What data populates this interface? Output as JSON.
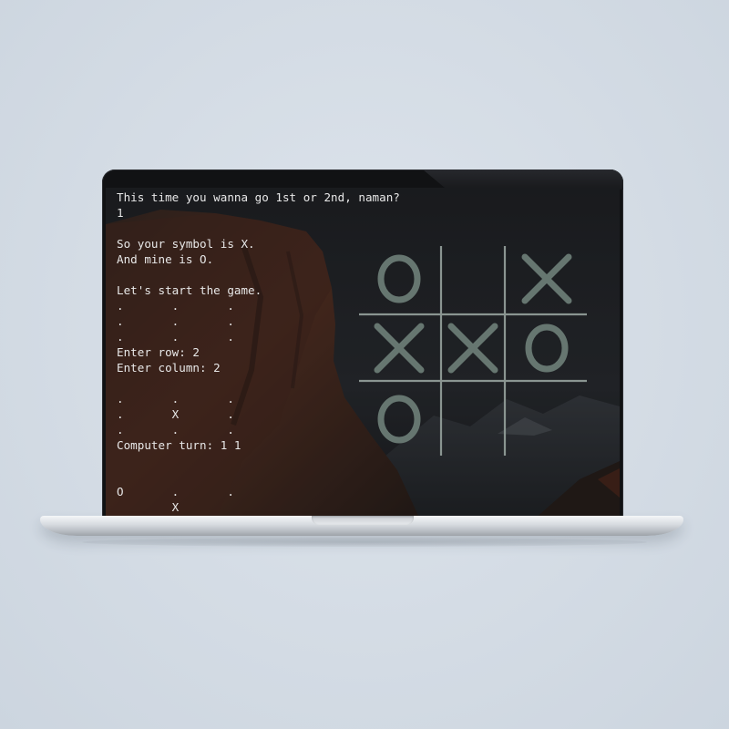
{
  "terminal": {
    "lines": [
      "This time you wanna go 1st or 2nd, naman?",
      "1",
      "",
      "So your symbol is X.",
      "And mine is O.",
      "",
      "Let's start the game.",
      ".       .       .",
      ".       .       .",
      ".       .       .",
      "Enter row: 2",
      "Enter column: 2",
      "",
      ".       .       .",
      ".       X       .",
      ".       .       .",
      "Computer turn: 1 1",
      "",
      "",
      "O       .       .",
      "        X        "
    ]
  },
  "board": {
    "cells": [
      "O",
      "",
      "X",
      "X",
      "X",
      "O",
      "O",
      "",
      ""
    ],
    "mark_color": "#667670",
    "line_color": "#8a9591"
  },
  "colors": {
    "background": "#d5dde6",
    "terminal_text": "#e8e8e8"
  }
}
